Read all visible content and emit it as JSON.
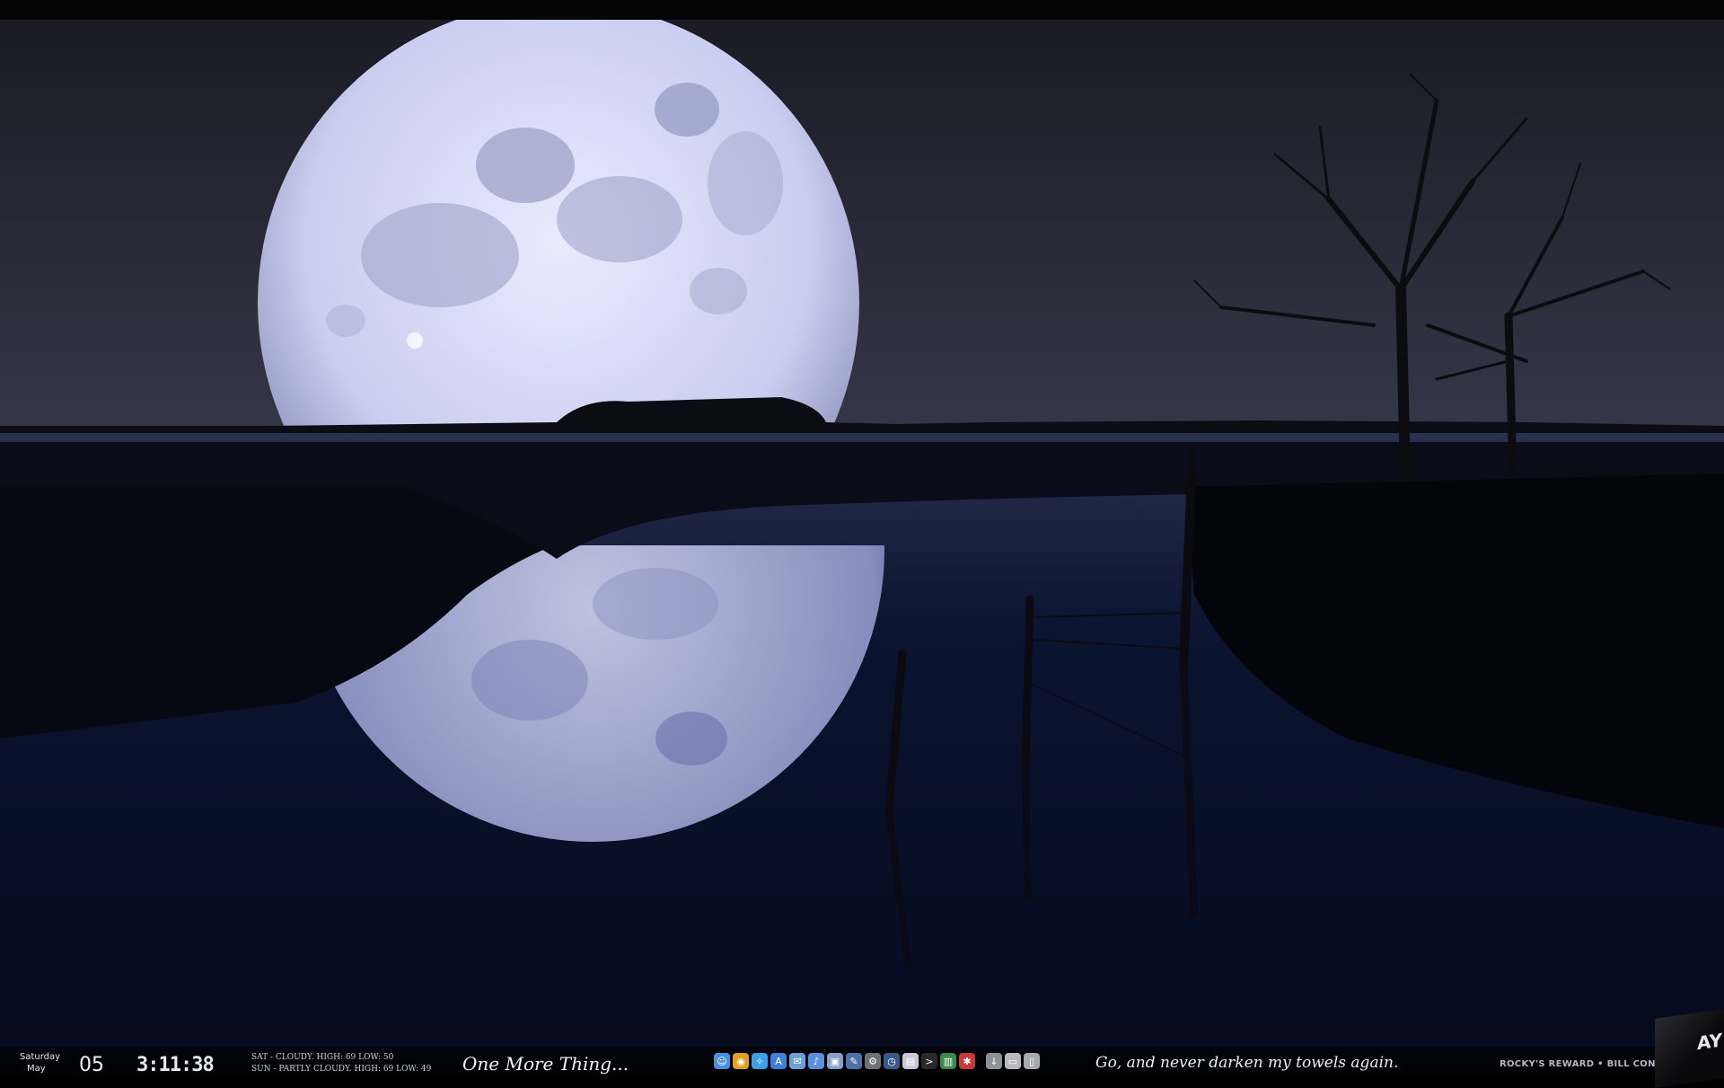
{
  "wallpaper": {
    "sky_top": "#1b1b24",
    "sky_horizon": "#343747",
    "water": "#0b1430",
    "moon_light": "#e9ecff",
    "moon_shadow": "#8a8fb8"
  },
  "status": {
    "day_name": "Saturday",
    "month": "May",
    "day_number": "05",
    "time": "3:11:38",
    "weather_line_1": "SAT - CLOUDY. HIGH: 69 LOW: 50",
    "weather_line_2": "SUN - PARTLY CLOUDY. HIGH: 69 LOW: 49",
    "tagline": "One More Thing...",
    "quote": "Go, and never darken my towels again.",
    "now_playing": "ROCKY'S REWARD • BILL CONTI"
  },
  "album": {
    "visible_text": "AY"
  },
  "dock": {
    "items": [
      {
        "icon": "finder-icon",
        "color": "#4a8fe0"
      },
      {
        "icon": "chrome-icon",
        "color": "#e0a020"
      },
      {
        "icon": "safari-icon",
        "color": "#3aa0e8"
      },
      {
        "icon": "app-store-icon",
        "color": "#3f7fd6"
      },
      {
        "icon": "mail-icon",
        "color": "#6a9fd8"
      },
      {
        "icon": "itunes-icon",
        "color": "#5b8fe0"
      },
      {
        "icon": "preview-icon",
        "color": "#8aa0c8"
      },
      {
        "icon": "utility-icon",
        "color": "#5070a8"
      },
      {
        "icon": "system-preferences-icon",
        "color": "#707078"
      },
      {
        "icon": "time-machine-icon",
        "color": "#3a5888"
      },
      {
        "icon": "photos-icon",
        "color": "#c8c8d8"
      },
      {
        "icon": "terminal-icon",
        "color": "#2a2a2a"
      },
      {
        "icon": "activity-monitor-icon",
        "color": "#3a8a4a"
      },
      {
        "icon": "torrent-icon",
        "color": "#c83a3a"
      },
      {
        "icon": "downloads-icon",
        "color": "#909098"
      },
      {
        "icon": "documents-icon",
        "color": "#b8b8c0"
      },
      {
        "icon": "trash-icon",
        "color": "#a8a8b0"
      }
    ]
  }
}
